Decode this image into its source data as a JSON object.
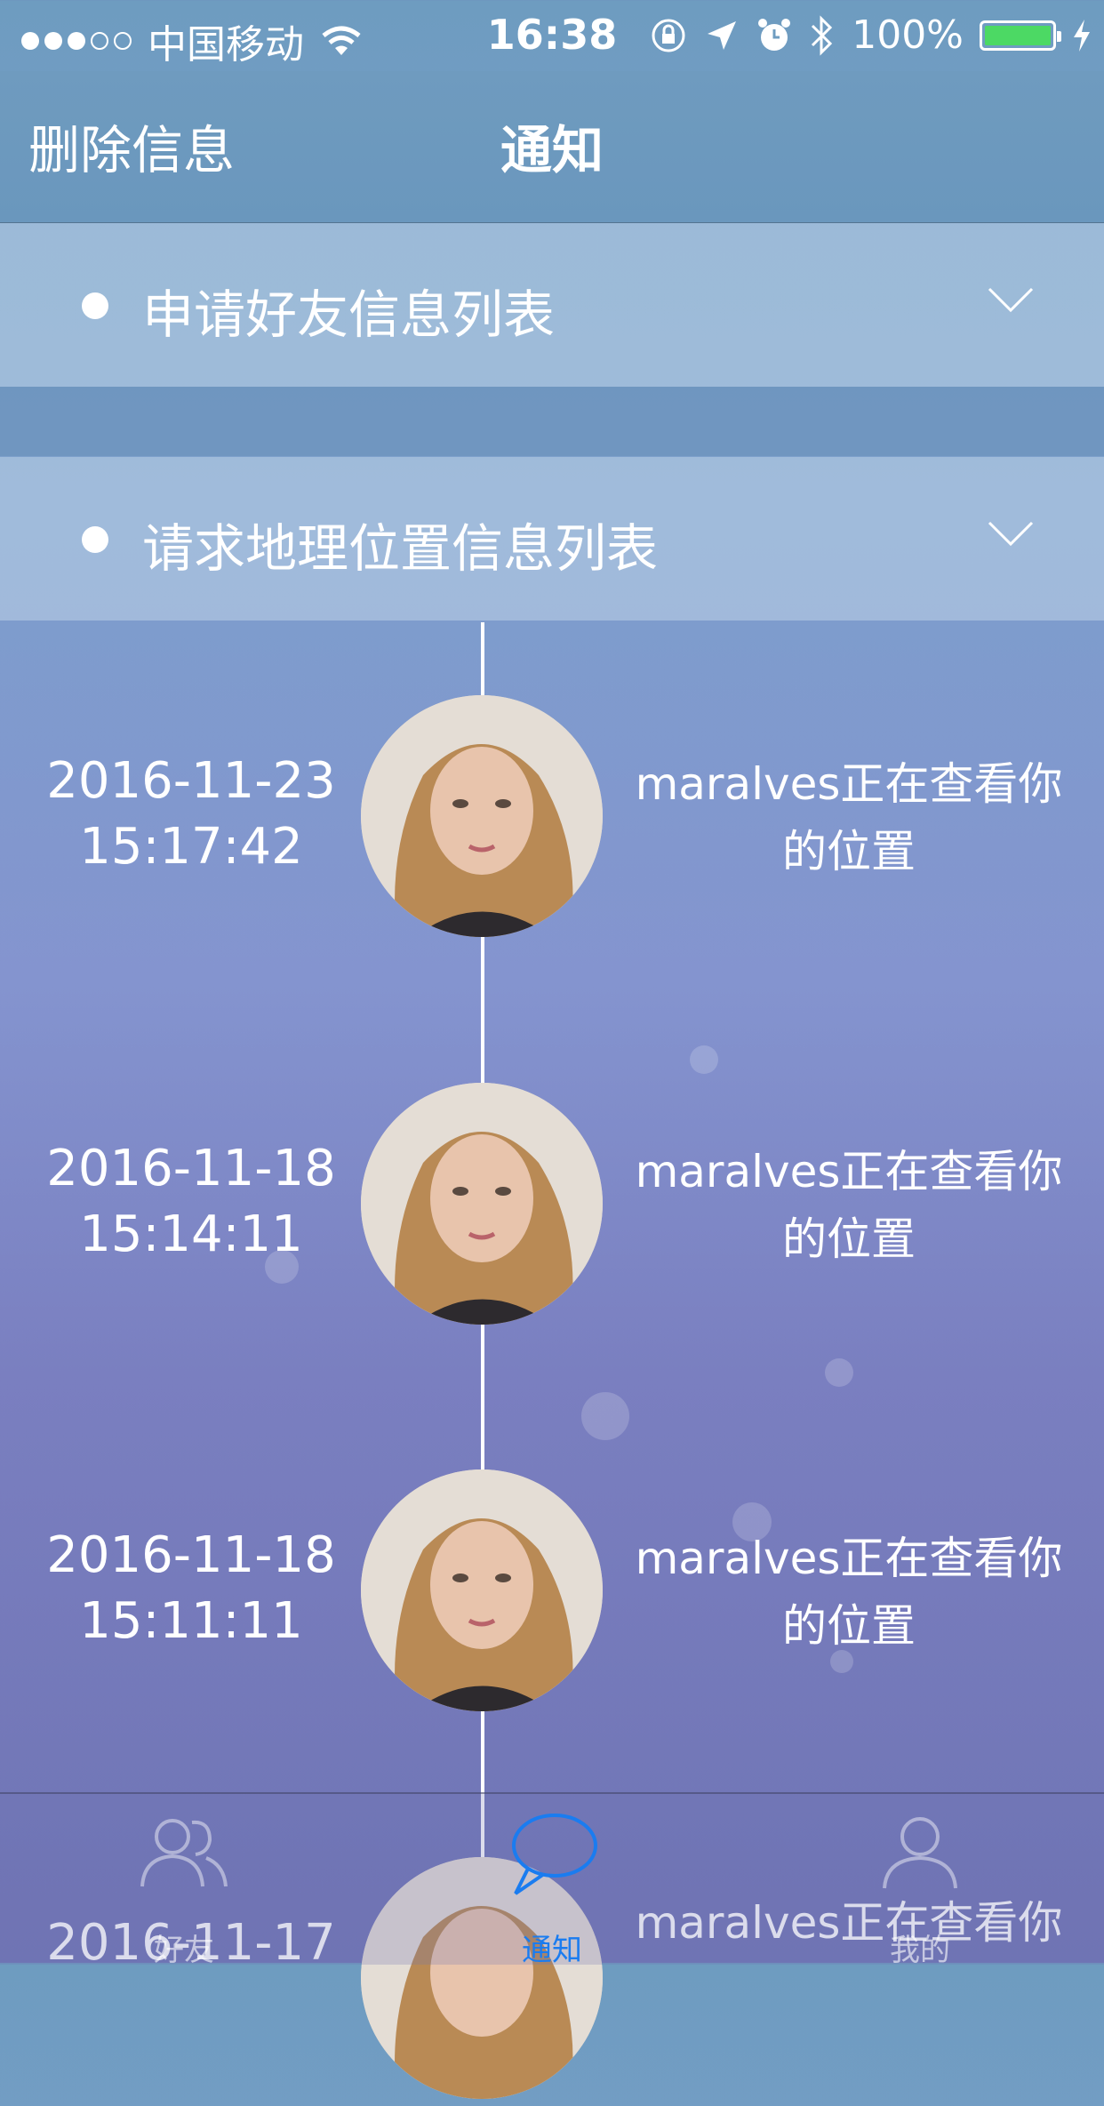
{
  "status_bar": {
    "carrier": "中国移动",
    "time": "16:38",
    "battery": "100%",
    "battery_color": "#4cd964"
  },
  "nav": {
    "left_button": "删除信息",
    "title": "通知"
  },
  "sections": [
    {
      "label": "申请好友信息列表",
      "icon": "chevron-down-icon"
    },
    {
      "label": "请求地理位置信息列表",
      "icon": "chevron-down-icon"
    }
  ],
  "timeline": [
    {
      "date": "2016-11-23",
      "time": "15:17:42",
      "message_line1": "maralves正在查看你",
      "message_line2": "的位置"
    },
    {
      "date": "2016-11-18",
      "time": "15:14:11",
      "message_line1": "maralves正在查看你",
      "message_line2": "的位置"
    },
    {
      "date": "2016-11-18",
      "time": "15:11:11",
      "message_line1": "maralves正在查看你",
      "message_line2": "的位置"
    },
    {
      "date": "2016-11-17",
      "time": "",
      "message_line1": "maralves正在查看你",
      "message_line2": ""
    }
  ],
  "tabs": [
    {
      "label": "好友",
      "icon": "friends-icon",
      "active": false
    },
    {
      "label": "通知",
      "icon": "chat-bubble-icon",
      "active": true
    },
    {
      "label": "我的",
      "icon": "profile-icon",
      "active": false
    }
  ],
  "colors": {
    "tab_active": "#1a7cf0"
  }
}
